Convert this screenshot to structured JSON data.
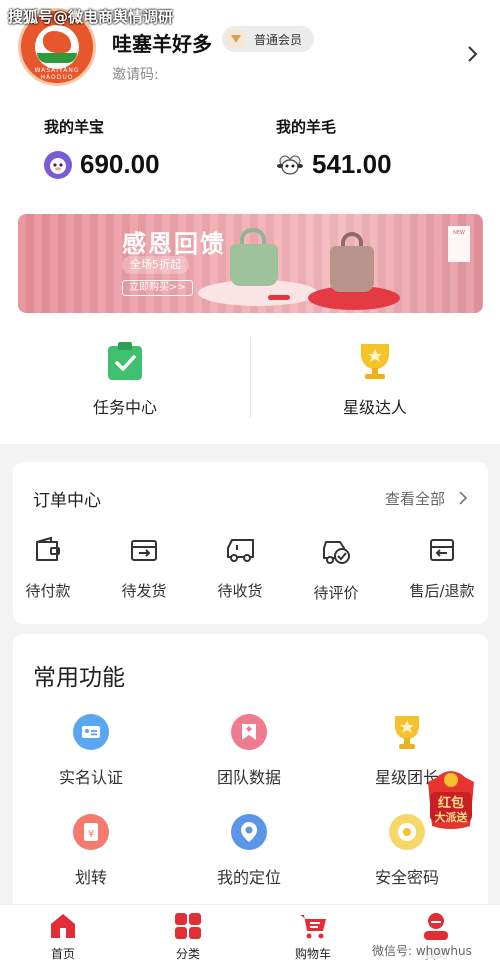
{
  "watermark_top": "搜狐号@微电商舆情调研",
  "watermark_bottom": "微信号: whowhus",
  "profile": {
    "name": "哇塞羊好多",
    "member_level": "普通会员",
    "invite_label": "邀请码:",
    "logo_text": "WASAIYANG HAODUO"
  },
  "accounts": [
    {
      "label": "我的羊宝",
      "value": "690.00",
      "icon": "sheep-coin-icon"
    },
    {
      "label": "我的羊毛",
      "value": "541.00",
      "icon": "wool-sheep-icon"
    }
  ],
  "banner": {
    "title": "感恩回馈",
    "subtitle": "全场5折起",
    "cta": "立即购买>>",
    "tag": "NEW"
  },
  "quick_links": [
    {
      "label": "任务中心",
      "icon": "task-clipboard-icon"
    },
    {
      "label": "星级达人",
      "icon": "trophy-icon"
    }
  ],
  "orders": {
    "title": "订单中心",
    "view_all": "查看全部",
    "items": [
      {
        "label": "待付款",
        "icon": "wallet-icon"
      },
      {
        "label": "待发货",
        "icon": "box-out-icon"
      },
      {
        "label": "待收货",
        "icon": "truck-icon"
      },
      {
        "label": "待评价",
        "icon": "review-icon"
      },
      {
        "label": "售后/退款",
        "icon": "refund-icon"
      }
    ]
  },
  "functions": {
    "title": "常用功能",
    "items": [
      {
        "label": "实名认证",
        "icon": "id-card-icon",
        "color": "#5aa6f0"
      },
      {
        "label": "团队数据",
        "icon": "team-data-icon",
        "color": "#f07b8e"
      },
      {
        "label": "星级团长",
        "icon": "trophy-icon",
        "color": "#f5c12e"
      },
      {
        "label": "划转",
        "icon": "transfer-icon",
        "color": "#f47a6e"
      },
      {
        "label": "我的定位",
        "icon": "location-icon",
        "color": "#5b95e8"
      },
      {
        "label": "安全密码",
        "icon": "lock-icon",
        "color": "#f5c12e"
      }
    ]
  },
  "redpack": {
    "line1": "红包",
    "line2": "大派送"
  },
  "tabs": [
    {
      "label": "首页",
      "icon": "home-icon"
    },
    {
      "label": "分类",
      "icon": "category-icon"
    },
    {
      "label": "购物车",
      "icon": "cart-icon"
    },
    {
      "label": "我的",
      "icon": "user-icon"
    }
  ],
  "colors": {
    "accent": "#e02e36",
    "gold": "#f5c12e"
  }
}
